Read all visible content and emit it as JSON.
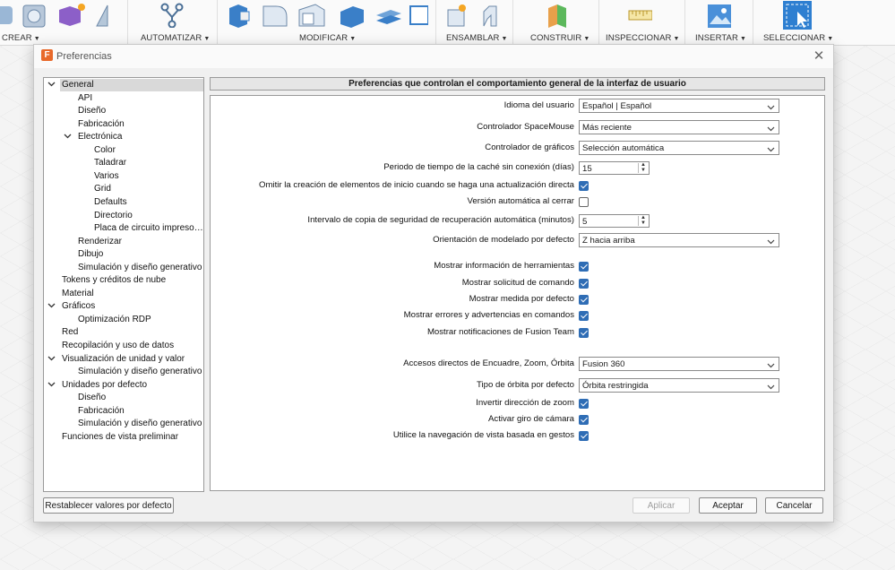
{
  "toolbar": {
    "groups": [
      {
        "label": "CREAR",
        "icon": "solid-create-icons"
      },
      {
        "label": "AUTOMATIZAR",
        "icon": "automate-icon"
      },
      {
        "label": "MODIFICAR",
        "icon": "modify-icons"
      },
      {
        "label": "ENSAMBLAR",
        "icon": "assemble-icons"
      },
      {
        "label": "CONSTRUIR",
        "icon": "construct-plane-icon"
      },
      {
        "label": "INSPECCIONAR",
        "icon": "measure-icon"
      },
      {
        "label": "INSERTAR",
        "icon": "insert-image-icon"
      },
      {
        "label": "SELECCIONAR",
        "icon": "select-icon"
      }
    ]
  },
  "dialog": {
    "title": "Preferencias",
    "app_icon_letter": "F",
    "close_glyph": "✕",
    "tree": [
      {
        "label": "General",
        "level": 0,
        "toggle": "v",
        "selected": true
      },
      {
        "label": "API",
        "level": 1
      },
      {
        "label": "Diseño",
        "level": 1
      },
      {
        "label": "Fabricación",
        "level": 1
      },
      {
        "label": "Electrónica",
        "level": 1,
        "toggle": "v"
      },
      {
        "label": "Color",
        "level": 2
      },
      {
        "label": "Taladrar",
        "level": 2
      },
      {
        "label": "Varios",
        "level": 2
      },
      {
        "label": "Grid",
        "level": 2
      },
      {
        "label": "Defaults",
        "level": 2
      },
      {
        "label": "Directorio",
        "level": 2
      },
      {
        "label": "Placa de circuito impreso…",
        "level": 2
      },
      {
        "label": "Renderizar",
        "level": 1
      },
      {
        "label": "Dibujo",
        "level": 1
      },
      {
        "label": "Simulación y diseño generativo",
        "level": 1
      },
      {
        "label": "Tokens y créditos de nube",
        "level": 0
      },
      {
        "label": "Material",
        "level": 0
      },
      {
        "label": "Gráficos",
        "level": 0,
        "toggle": "v"
      },
      {
        "label": "Optimización RDP",
        "level": 1
      },
      {
        "label": "Red",
        "level": 0
      },
      {
        "label": "Recopilación y uso de datos",
        "level": 0
      },
      {
        "label": "Visualización de unidad y valor",
        "level": 0,
        "toggle": "v"
      },
      {
        "label": "Simulación y diseño generativo",
        "level": 1
      },
      {
        "label": "Unidades por defecto",
        "level": 0,
        "toggle": "v"
      },
      {
        "label": "Diseño",
        "level": 1
      },
      {
        "label": "Fabricación",
        "level": 1
      },
      {
        "label": "Simulación y diseño generativo",
        "level": 1
      },
      {
        "label": "Funciones de vista preliminar",
        "level": 0
      }
    ],
    "header": "Preferencias que controlan el comportamiento general de la interfaz de usuario",
    "settings": [
      {
        "label": "Idioma del usuario",
        "type": "dropdown",
        "value": "Español | Español"
      },
      {
        "label": "Controlador SpaceMouse",
        "type": "dropdown",
        "value": "Más reciente"
      },
      {
        "label": "Controlador de gráficos",
        "type": "dropdown",
        "value": "Selección automática"
      },
      {
        "label": "Periodo de tiempo de la caché sin conexión (días)",
        "type": "spin",
        "value": "15"
      },
      {
        "label": "Omitir la creación de elementos de inicio cuando se haga una actualización directa",
        "type": "checkbox",
        "checked": true
      },
      {
        "label": "Versión automática al cerrar",
        "type": "checkbox",
        "checked": false
      },
      {
        "label": "Intervalo de copia de seguridad de recuperación automática (minutos)",
        "type": "spin",
        "value": "5"
      },
      {
        "label": "Orientación de modelado por defecto",
        "type": "dropdown",
        "value": "Z hacia arriba"
      },
      {
        "label": "Mostrar información de herramientas",
        "type": "checkbox",
        "checked": true
      },
      {
        "label": "Mostrar solicitud de comando",
        "type": "checkbox",
        "checked": true
      },
      {
        "label": "Mostrar medida por defecto",
        "type": "checkbox",
        "checked": true
      },
      {
        "label": "Mostrar errores y advertencias en comandos",
        "type": "checkbox",
        "checked": true
      },
      {
        "label": "Mostrar notificaciones de Fusion Team",
        "type": "checkbox",
        "checked": true
      },
      {
        "label": "Accesos directos de Encuadre, Zoom, Órbita",
        "type": "dropdown",
        "value": "Fusion 360"
      },
      {
        "label": "Tipo de órbita por defecto",
        "type": "dropdown",
        "value": "Órbita restringida"
      },
      {
        "label": "Invertir dirección de zoom",
        "type": "checkbox",
        "checked": true
      },
      {
        "label": "Activar giro de cámara",
        "type": "checkbox",
        "checked": true
      },
      {
        "label": "Utilice la navegación de vista basada en gestos",
        "type": "checkbox",
        "checked": true
      }
    ],
    "buttons": {
      "reset": "Restablecer valores por defecto",
      "apply": "Aplicar",
      "accept": "Aceptar",
      "cancel": "Cancelar"
    }
  },
  "colors": {
    "accent": "#2f6db5",
    "app_icon": "#e8692a",
    "toolbar_blue": "#2e7fd1"
  }
}
